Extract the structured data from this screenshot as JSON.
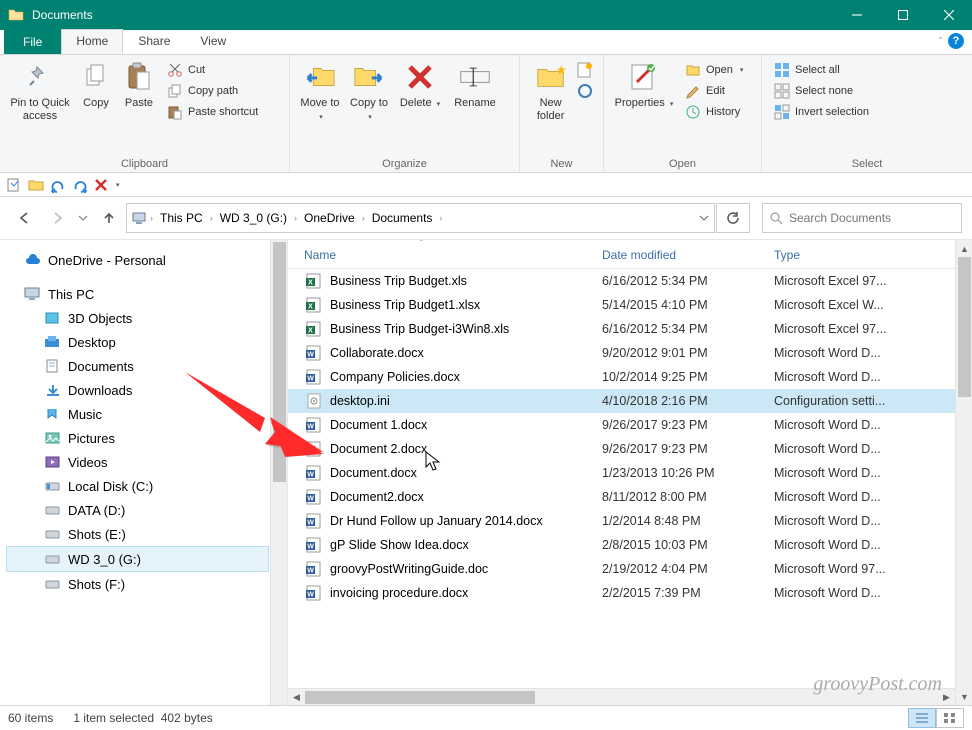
{
  "window": {
    "title": "Documents"
  },
  "tabs": {
    "file": "File",
    "home": "Home",
    "share": "Share",
    "view": "View"
  },
  "ribbon": {
    "clipboard": {
      "label": "Clipboard",
      "pin": "Pin to Quick access",
      "copy": "Copy",
      "paste": "Paste",
      "cut": "Cut",
      "copypath": "Copy path",
      "pasteshortcut": "Paste shortcut"
    },
    "organize": {
      "label": "Organize",
      "moveto": "Move to",
      "copyto": "Copy to",
      "delete": "Delete",
      "rename": "Rename"
    },
    "new": {
      "label": "New",
      "newfolder": "New folder"
    },
    "open": {
      "label": "Open",
      "properties": "Properties",
      "open": "Open",
      "edit": "Edit",
      "history": "History"
    },
    "select": {
      "label": "Select",
      "all": "Select all",
      "none": "Select none",
      "invert": "Invert selection"
    }
  },
  "breadcrumb": {
    "parts": [
      "This PC",
      "WD 3_0 (G:)",
      "OneDrive",
      "Documents"
    ]
  },
  "search": {
    "placeholder": "Search Documents"
  },
  "sidebar": {
    "onedrive": "OneDrive - Personal",
    "thispc": "This PC",
    "items": [
      "3D Objects",
      "Desktop",
      "Documents",
      "Downloads",
      "Music",
      "Pictures",
      "Videos",
      "Local Disk (C:)",
      "DATA (D:)",
      "Shots (E:)",
      "WD 3_0 (G:)",
      "Shots (F:)"
    ]
  },
  "columns": {
    "name": "Name",
    "date": "Date modified",
    "type": "Type"
  },
  "files": [
    {
      "name": "Business Trip Budget.xls",
      "date": "6/16/2012 5:34 PM",
      "type": "Microsoft Excel 97...",
      "iconKind": "xls"
    },
    {
      "name": "Business Trip Budget1.xlsx",
      "date": "5/14/2015 4:10 PM",
      "type": "Microsoft Excel W...",
      "iconKind": "xls"
    },
    {
      "name": "Business Trip Budget-i3Win8.xls",
      "date": "6/16/2012 5:34 PM",
      "type": "Microsoft Excel 97...",
      "iconKind": "xls"
    },
    {
      "name": "Collaborate.docx",
      "date": "9/20/2012 9:01 PM",
      "type": "Microsoft Word D...",
      "iconKind": "doc"
    },
    {
      "name": "Company Policies.docx",
      "date": "10/2/2014 9:25 PM",
      "type": "Microsoft Word D...",
      "iconKind": "doc"
    },
    {
      "name": "desktop.ini",
      "date": "4/10/2018 2:16 PM",
      "type": "Configuration setti...",
      "iconKind": "ini",
      "selected": true
    },
    {
      "name": "Document 1.docx",
      "date": "9/26/2017 9:23 PM",
      "type": "Microsoft Word D...",
      "iconKind": "doc"
    },
    {
      "name": "Document 2.docx",
      "date": "9/26/2017 9:23 PM",
      "type": "Microsoft Word D...",
      "iconKind": "doc"
    },
    {
      "name": "Document.docx",
      "date": "1/23/2013 10:26 PM",
      "type": "Microsoft Word D...",
      "iconKind": "doc"
    },
    {
      "name": "Document2.docx",
      "date": "8/11/2012 8:00 PM",
      "type": "Microsoft Word D...",
      "iconKind": "doc"
    },
    {
      "name": "Dr Hund Follow up January 2014.docx",
      "date": "1/2/2014 8:48 PM",
      "type": "Microsoft Word D...",
      "iconKind": "doc"
    },
    {
      "name": "gP Slide Show Idea.docx",
      "date": "2/8/2015 10:03 PM",
      "type": "Microsoft Word D...",
      "iconKind": "doc"
    },
    {
      "name": "groovyPostWritingGuide.doc",
      "date": "2/19/2012 4:04 PM",
      "type": "Microsoft Word 97...",
      "iconKind": "doc"
    },
    {
      "name": "invoicing procedure.docx",
      "date": "2/2/2015 7:39 PM",
      "type": "Microsoft Word D...",
      "iconKind": "doc"
    }
  ],
  "status": {
    "count": "60 items",
    "selection": "1 item selected",
    "size": "402 bytes"
  },
  "watermark": "groovyPost.com"
}
